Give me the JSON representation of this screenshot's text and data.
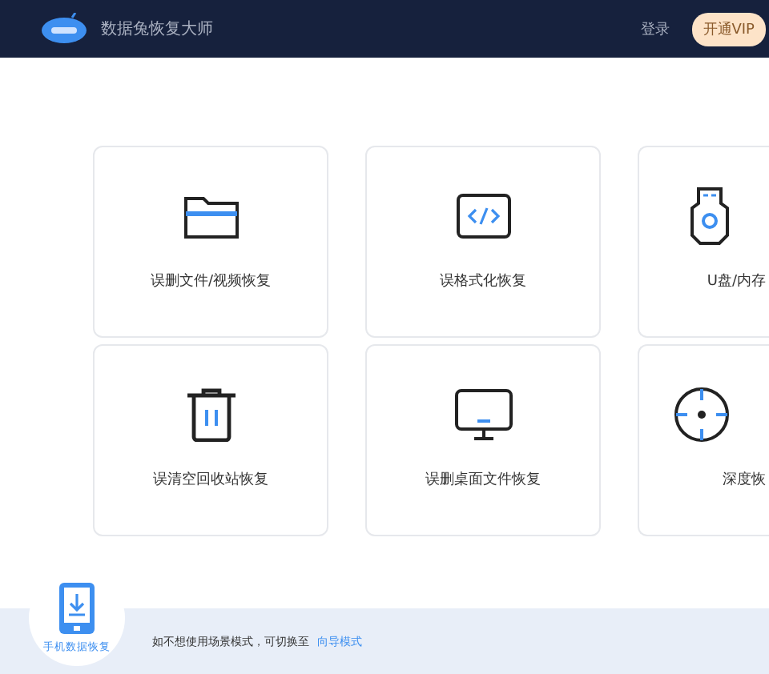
{
  "header": {
    "title": "数据兔恢复大师",
    "login": "登录",
    "vip_button": "开通VIP"
  },
  "cards": [
    {
      "label": "误删文件/视频恢复"
    },
    {
      "label": "误格式化恢复"
    },
    {
      "label": "U盘/内存"
    },
    {
      "label": "误清空回收站恢复"
    },
    {
      "label": "误删桌面文件恢复"
    },
    {
      "label": "深度恢"
    }
  ],
  "phone_recovery": {
    "label": "手机数据恢复"
  },
  "footer": {
    "text": "如不想使用场景模式，可切换至",
    "link": "向导模式"
  }
}
